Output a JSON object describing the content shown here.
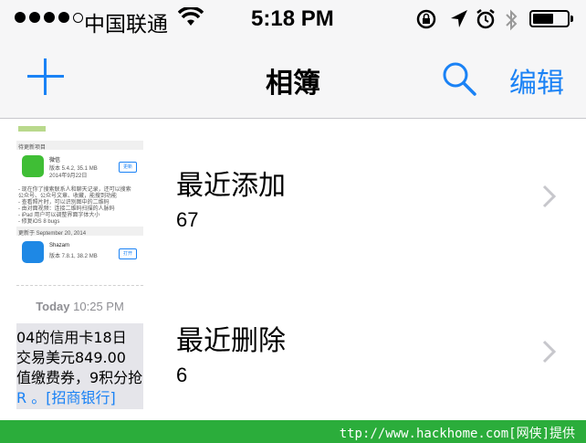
{
  "status_bar": {
    "carrier": "中国联通",
    "time": "5:18 PM",
    "signal_bars": "4 of 5",
    "battery_level": 0.5
  },
  "nav": {
    "title": "相簿",
    "edit_label": "编辑",
    "accent_color": "#1a82f5"
  },
  "albums": [
    {
      "name": "最近添加",
      "count": "67",
      "thumbnail": {
        "section1": "待更新项目",
        "app1_name": "微信",
        "app1_meta": "版本 5.4.2, 35.1 MB",
        "app1_date": "2014年9月22日",
        "app1_button": "更新",
        "notes": [
          "- 现在你了搜索联系人和聊天记录，还可以搜索",
          "公众号、公众号文章、收藏，能搜到功能",
          "- 查看照片时，可以识别图中的二维码",
          "- 由对面视频：连接二维码扫描的人脉码",
          "- iPad 用户可以调整界面字体大小",
          "- 修复iOS 8 bugs"
        ],
        "section2": "更新于 September 20, 2014",
        "app2_name": "Shazam",
        "app2_meta": "版本 7.8.1, 38.2 MB",
        "app2_button": "打开"
      }
    },
    {
      "name": "最近删除",
      "count": "6",
      "thumbnail": {
        "timestamp_label": "Today",
        "timestamp_time": "10:25 PM",
        "lines": [
          "04的信用卡18日",
          "交易美元849.00",
          "值缴费券，9积分抢",
          "R 。[招商银行]"
        ]
      }
    }
  ],
  "watermark": "ttp://www.hackhome.com[网侠]提供"
}
